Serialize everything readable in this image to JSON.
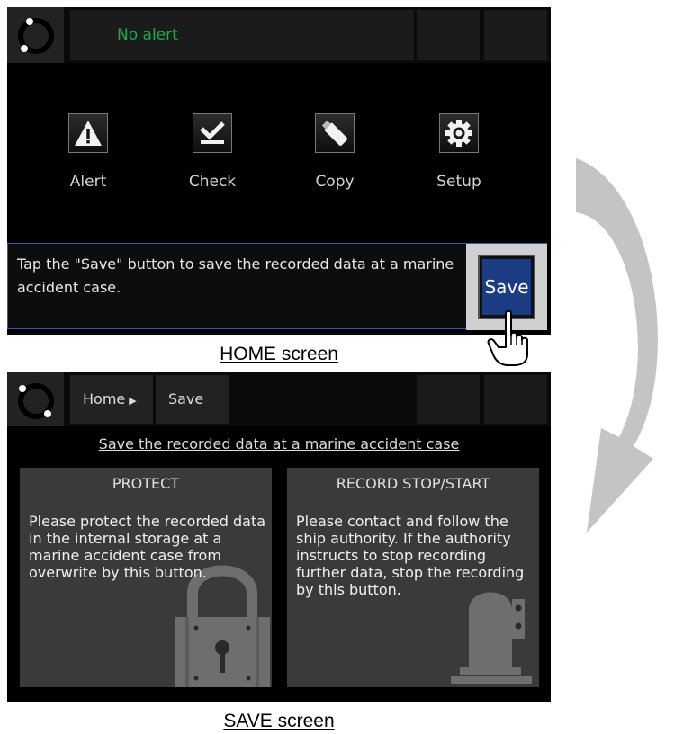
{
  "home": {
    "alert_text": "No alert",
    "menu": [
      {
        "label": "Alert",
        "icon": "alert-triangle-icon"
      },
      {
        "label": "Check",
        "icon": "checkmark-icon"
      },
      {
        "label": "Copy",
        "icon": "usb-stick-icon"
      },
      {
        "label": "Setup",
        "icon": "gear-icon"
      }
    ],
    "message": "Tap the \"Save\" button to save the recorded data at a marine accident case.",
    "save_label": "Save",
    "caption": "HOME screen"
  },
  "save_screen": {
    "breadcrumb_home": "Home",
    "breadcrumb_save": "Save",
    "title": "Save the recorded data at a marine accident case",
    "protect": {
      "heading": "PROTECT",
      "body": "Please protect the recorded data in the internal storage at a marine accident case from overwrite by this button.",
      "icon": "padlock-icon"
    },
    "record": {
      "heading": "RECORD STOP/START",
      "body": "Please contact and follow the ship authority. If the authority instructs to stop recording further data, stop the recording by this button.",
      "icon": "recorder-icon"
    },
    "caption": "SAVE screen"
  },
  "colors": {
    "alert_text": "#1fa84a",
    "save_button": "#1c3c83",
    "message_border": "#2c5fb0",
    "panel": "#3a3a3a"
  }
}
